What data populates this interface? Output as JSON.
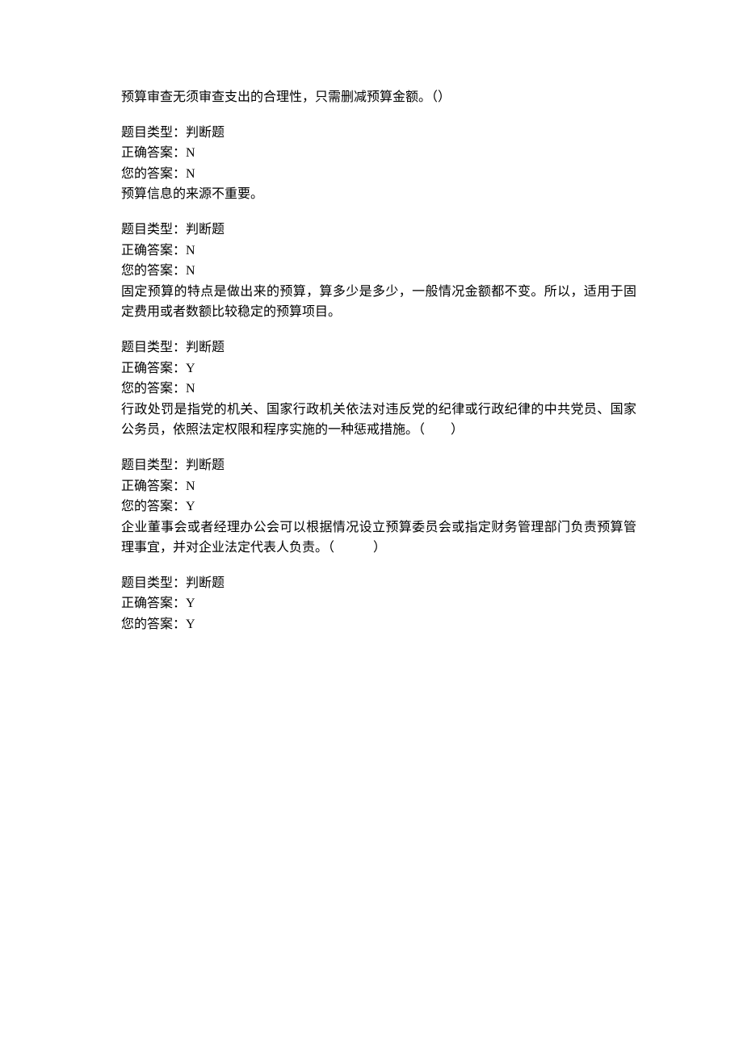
{
  "labels": {
    "type": "题目类型：",
    "correct": "正确答案：",
    "yours": "您的答案："
  },
  "items": [
    {
      "prompt": "预算审查无须审查支出的合理性，只需删减预算金额。（）",
      "type": "判断题",
      "correct": "N",
      "yours": "N",
      "next_prompt": "预算信息的来源不重要。"
    },
    {
      "prompt": "",
      "type": "判断题",
      "correct": "N",
      "yours": "N",
      "next_prompt": "固定预算的特点是做出来的预算，算多少是多少，一般情况金额都不变。所以，适用于固定费用或者数额比较稳定的预算项目。"
    },
    {
      "prompt": "",
      "type": "判断题",
      "correct": "Y",
      "yours": "N",
      "next_prompt": "行政处罚是指党的机关、国家行政机关依法对违反党的纪律或行政纪律的中共党员、国家公务员，依照法定权限和程序实施的一种惩戒措施。（　　）"
    },
    {
      "prompt": "",
      "type": "判断题",
      "correct": "N",
      "yours": "Y",
      "next_prompt": "企业董事会或者经理办公会可以根据情况设立预算委员会或指定财务管理部门负责预算管理事宜，并对企业法定代表人负责。（　　　）"
    },
    {
      "prompt": "",
      "type": "判断题",
      "correct": "Y",
      "yours": "Y",
      "next_prompt": ""
    }
  ]
}
